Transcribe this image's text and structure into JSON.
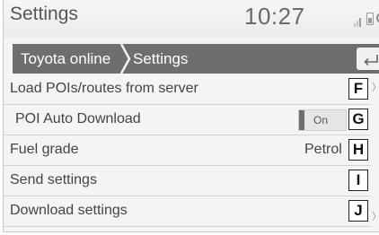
{
  "status_bar": {
    "title": "Settings",
    "time": "10:27",
    "icons": [
      "signal-icon",
      "battery-icon",
      "connection-icon"
    ]
  },
  "breadcrumb": {
    "items": [
      "Toyota online",
      "Settings"
    ],
    "back_icon": "back-arrow-icon"
  },
  "rows": [
    {
      "label": "Load POIs/routes from server",
      "value": "",
      "callout": "F"
    },
    {
      "label": "POI Auto Download",
      "value": "On",
      "callout": "G"
    },
    {
      "label": "Fuel grade",
      "value": "Petrol",
      "callout": "H"
    },
    {
      "label": "Send settings",
      "value": "",
      "callout": "I"
    },
    {
      "label": "Download settings",
      "value": "",
      "callout": "J"
    }
  ],
  "colors": {
    "breadcrumb_bg": "#6e6e6e",
    "toggle_on": "#6e6e6e",
    "background": "#f4f4f4"
  }
}
